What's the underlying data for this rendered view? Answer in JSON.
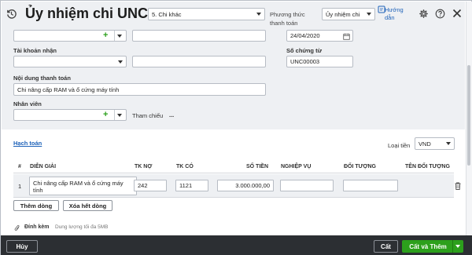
{
  "header": {
    "title": "Ủy nhiệm chi UNC...",
    "reason_select": "5. Chi khác",
    "payment_method_label": "Phương thức thanh toán",
    "payment_method_value": "Ủy nhiệm chi",
    "help_label": "Hướng dẫn"
  },
  "form": {
    "posting_date": "24/04/2020",
    "receiving_account_label": "Tài khoản nhận",
    "voucher_no_label": "Số chứng từ",
    "voucher_no": "UNC00003",
    "content_label": "Nội dung thanh toán",
    "content_value": "Chi nâng cấp RAM và ổ cứng máy tính",
    "employee_label": "Nhân viên",
    "reference_label": "Tham chiếu",
    "reference_more": "..."
  },
  "accounting": {
    "tab_label": "Hạch toán",
    "currency_label": "Loại tiền",
    "currency_value": "VND",
    "columns": [
      "#",
      "DIỄN GIẢI",
      "TK NỢ",
      "TK CÓ",
      "SỐ TIỀN",
      "NGHIỆP VỤ",
      "ĐỐI TƯỢNG",
      "TÊN ĐỐI TƯỢNG"
    ],
    "rows": [
      {
        "no": "1",
        "description": "Chi nâng cấp RAM và ổ cứng máy tính",
        "debit_account": "242",
        "credit_account": "1121",
        "amount": "3.000.000,00",
        "business": "",
        "object": "",
        "object_name": ""
      }
    ],
    "add_row_label": "Thêm dòng",
    "delete_all_label": "Xóa hết dòng"
  },
  "attachment": {
    "label": "Đính kèm",
    "hint": "Dung lượng tối đa 5MB"
  },
  "footer": {
    "cancel_label": "Hủy",
    "save_label": "Cất",
    "save_add_label": "Cất và Thêm"
  },
  "colors": {
    "accent_green": "#2ca01c",
    "link_blue": "#1e62b9",
    "footer_bg": "#2c2f33"
  }
}
